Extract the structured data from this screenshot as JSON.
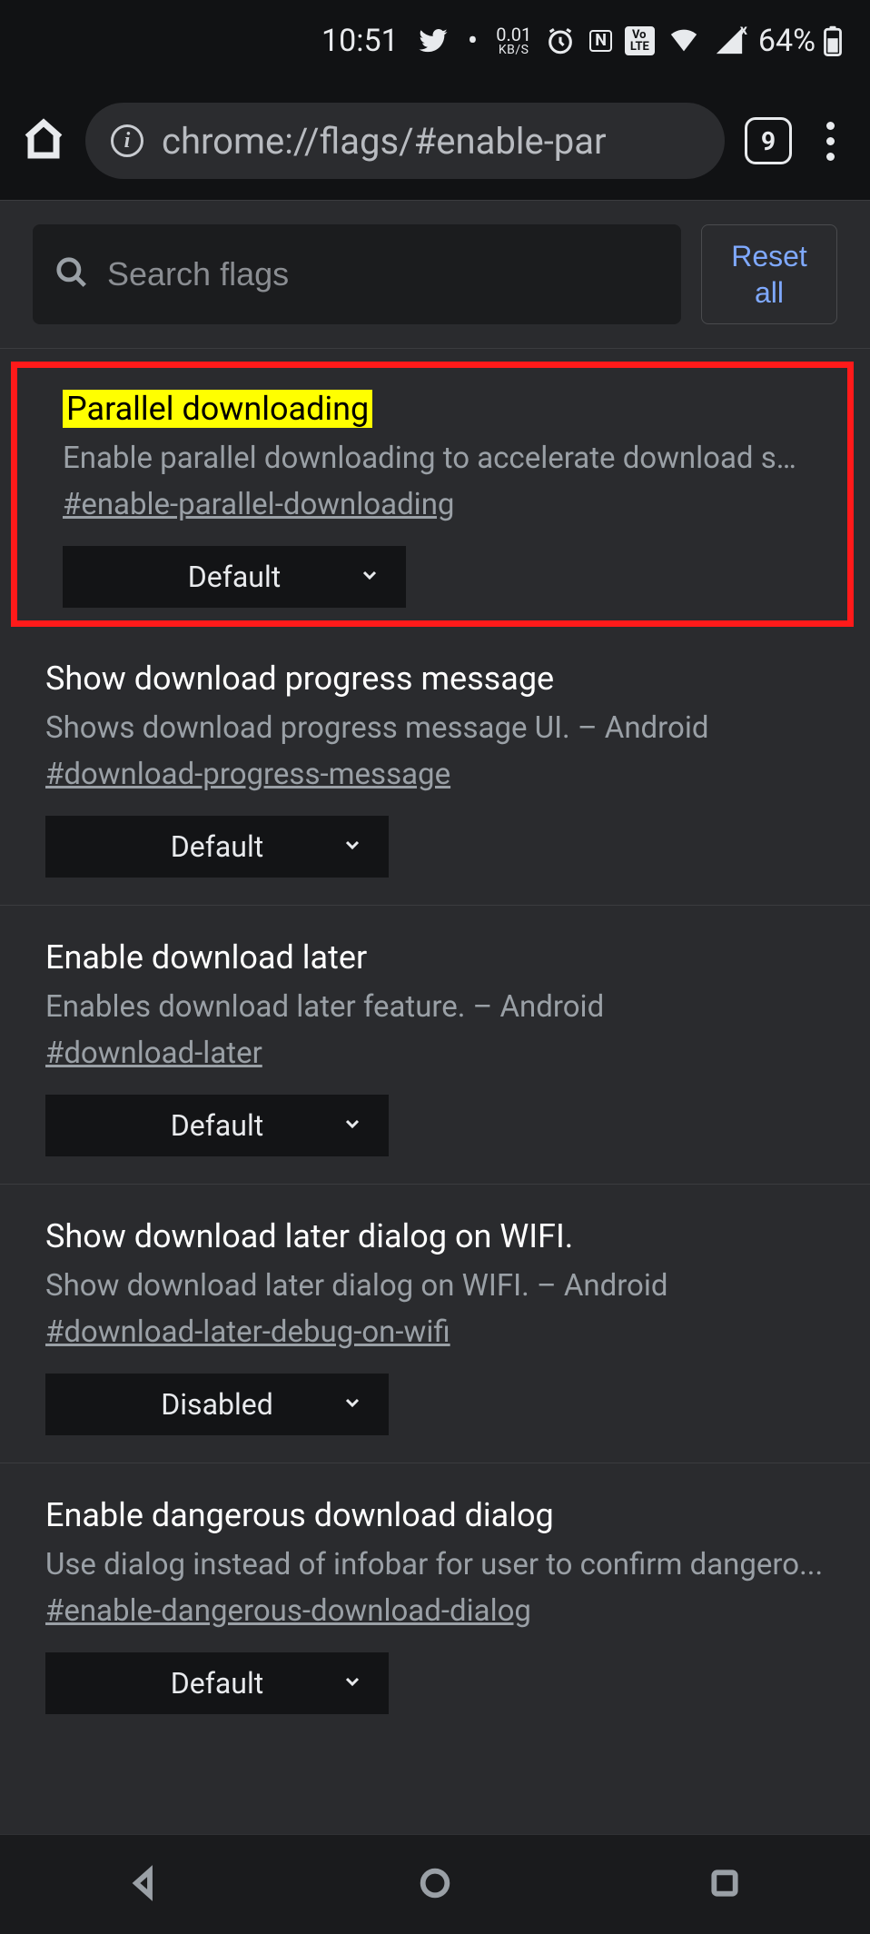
{
  "status_bar": {
    "time": "10:51",
    "net_value": "0.01",
    "net_unit": "KB/S",
    "battery_pct": "64%",
    "volte_label": "Vo·\nLTE",
    "nfc_label": "N"
  },
  "browser": {
    "url": "chrome://flags/#enable-par",
    "tab_count": "9"
  },
  "search": {
    "placeholder": "Search flags",
    "reset_label": "Reset all"
  },
  "flags": [
    {
      "highlighted": true,
      "title": "Parallel downloading",
      "description": "Enable parallel downloading to accelerate download spe...",
      "hash": "#enable-parallel-downloading",
      "value": "Default"
    },
    {
      "title": "Show download progress message",
      "description": "Shows download progress message UI. – Android",
      "hash": "#download-progress-message",
      "value": "Default"
    },
    {
      "title": "Enable download later",
      "description": "Enables download later feature. – Android",
      "hash": "#download-later",
      "value": "Default"
    },
    {
      "title": "Show download later dialog on WIFI.",
      "description": "Show download later dialog on WIFI. – Android",
      "hash": "#download-later-debug-on-wifi",
      "value": "Disabled"
    },
    {
      "title": "Enable dangerous download dialog",
      "description": "Use dialog instead of infobar for user to confirm dangero...",
      "hash": "#enable-dangerous-download-dialog",
      "value": "Default"
    }
  ]
}
